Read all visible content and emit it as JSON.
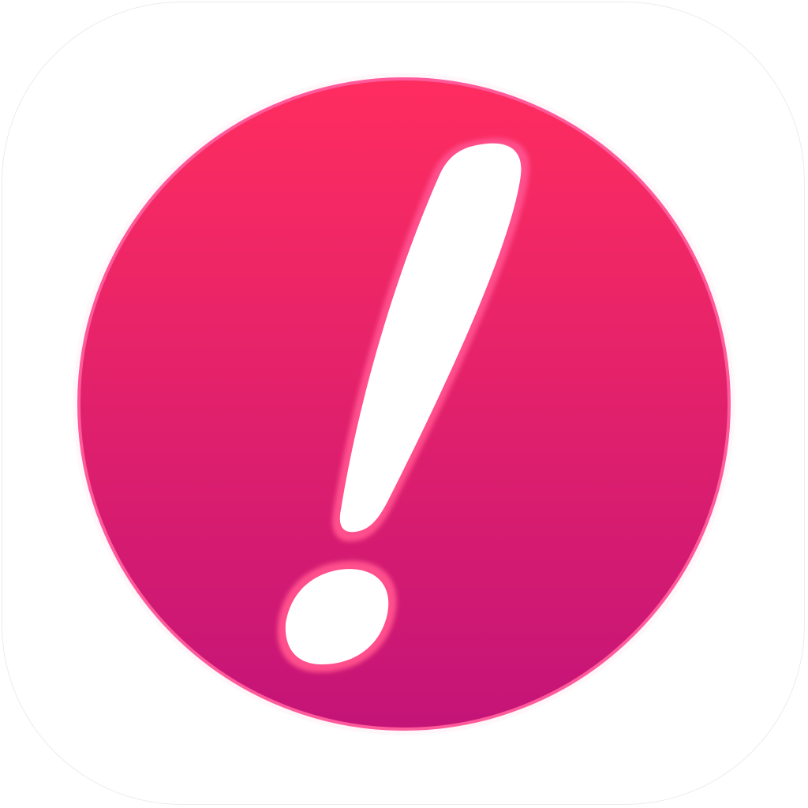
{
  "app_icon": {
    "icon_name": "exclamation-mark-icon",
    "colors": {
      "tile_background": "#ffffff",
      "disc_top": "#ff2d5f",
      "disc_bottom": "#c41478",
      "disc_rim": "#ff5a9a",
      "glyph_fill": "#ffffff",
      "glyph_edge": "#d81b6a"
    }
  }
}
